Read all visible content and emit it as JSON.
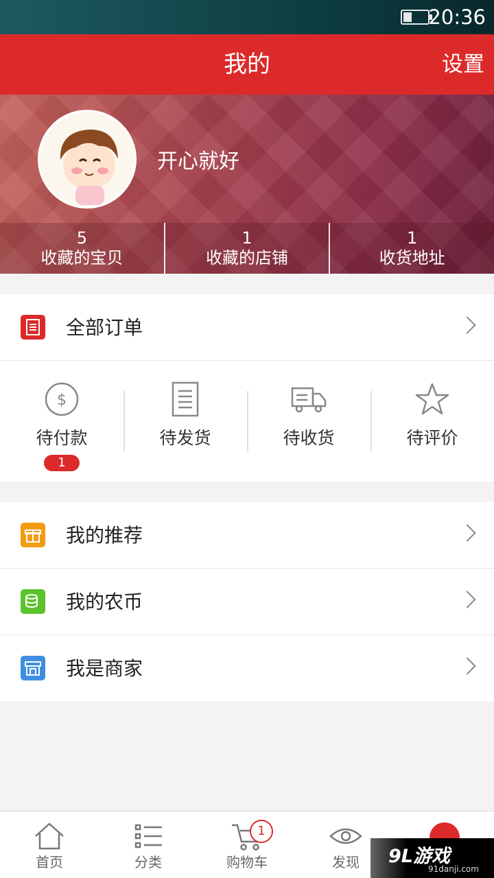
{
  "status_bar": {
    "time": "20:36"
  },
  "header": {
    "title": "我的",
    "settings": "设置"
  },
  "profile": {
    "username": "开心就好",
    "stats": [
      {
        "num": "5",
        "label": "收藏的宝贝"
      },
      {
        "num": "1",
        "label": "收藏的店铺"
      },
      {
        "num": "1",
        "label": "收货地址"
      }
    ]
  },
  "orders": {
    "all_label": "全部订单",
    "statuses": [
      {
        "label": "待付款",
        "icon": "dollar-circle-icon",
        "badge": "1"
      },
      {
        "label": "待发货",
        "icon": "document-icon"
      },
      {
        "label": "待收货",
        "icon": "truck-icon"
      },
      {
        "label": "待评价",
        "icon": "star-icon"
      }
    ]
  },
  "menu": [
    {
      "label": "我的推荐",
      "icon": "gift-icon",
      "color": "#f39c12"
    },
    {
      "label": "我的农币",
      "icon": "coins-icon",
      "color": "#5cc22e"
    },
    {
      "label": "我是商家",
      "icon": "shop-icon",
      "color": "#3f8fe0"
    }
  ],
  "tabbar": {
    "items": [
      {
        "label": "首页",
        "icon": "home-icon"
      },
      {
        "label": "分类",
        "icon": "list-icon"
      },
      {
        "label": "购物车",
        "icon": "cart-icon",
        "badge": "1"
      },
      {
        "label": "发现",
        "icon": "eye-icon"
      },
      {
        "label": "",
        "icon": "profile-icon"
      }
    ]
  },
  "watermark": {
    "logo": "9L游戏",
    "url": "91danji.com"
  },
  "colors": {
    "primary": "#dc2a2a",
    "background": "#f3f3f3"
  }
}
